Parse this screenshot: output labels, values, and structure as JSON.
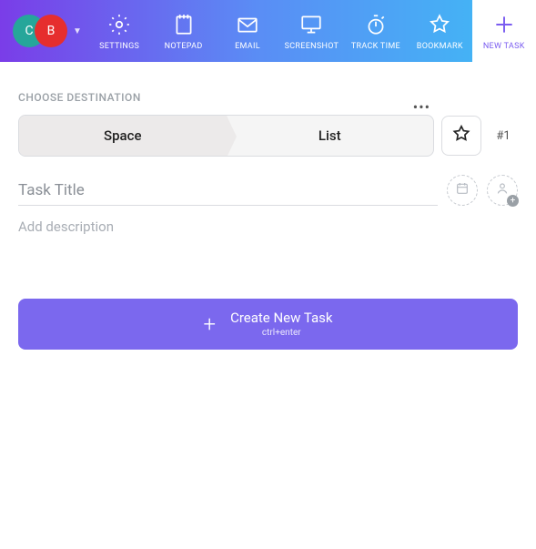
{
  "avatars": {
    "c": "C",
    "b": "B"
  },
  "topbar": [
    {
      "key": "settings",
      "label": "SETTINGS"
    },
    {
      "key": "notepad",
      "label": "NOTEPAD"
    },
    {
      "key": "email",
      "label": "EMAIL"
    },
    {
      "key": "screenshot",
      "label": "SCREENSHOT"
    },
    {
      "key": "tracktime",
      "label": "TRACK TIME"
    },
    {
      "key": "bookmark",
      "label": "BOOKMARK"
    },
    {
      "key": "newtask",
      "label": "NEW TASK"
    }
  ],
  "section_label": "CHOOSE DESTINATION",
  "segments": {
    "space": "Space",
    "list": "List"
  },
  "list_number": "#1",
  "task_title_value": "",
  "task_title_placeholder": "Task Title",
  "description_placeholder": "Add description",
  "description_value": "",
  "create_button": {
    "label": "Create New Task",
    "hint": "ctrl+enter"
  }
}
